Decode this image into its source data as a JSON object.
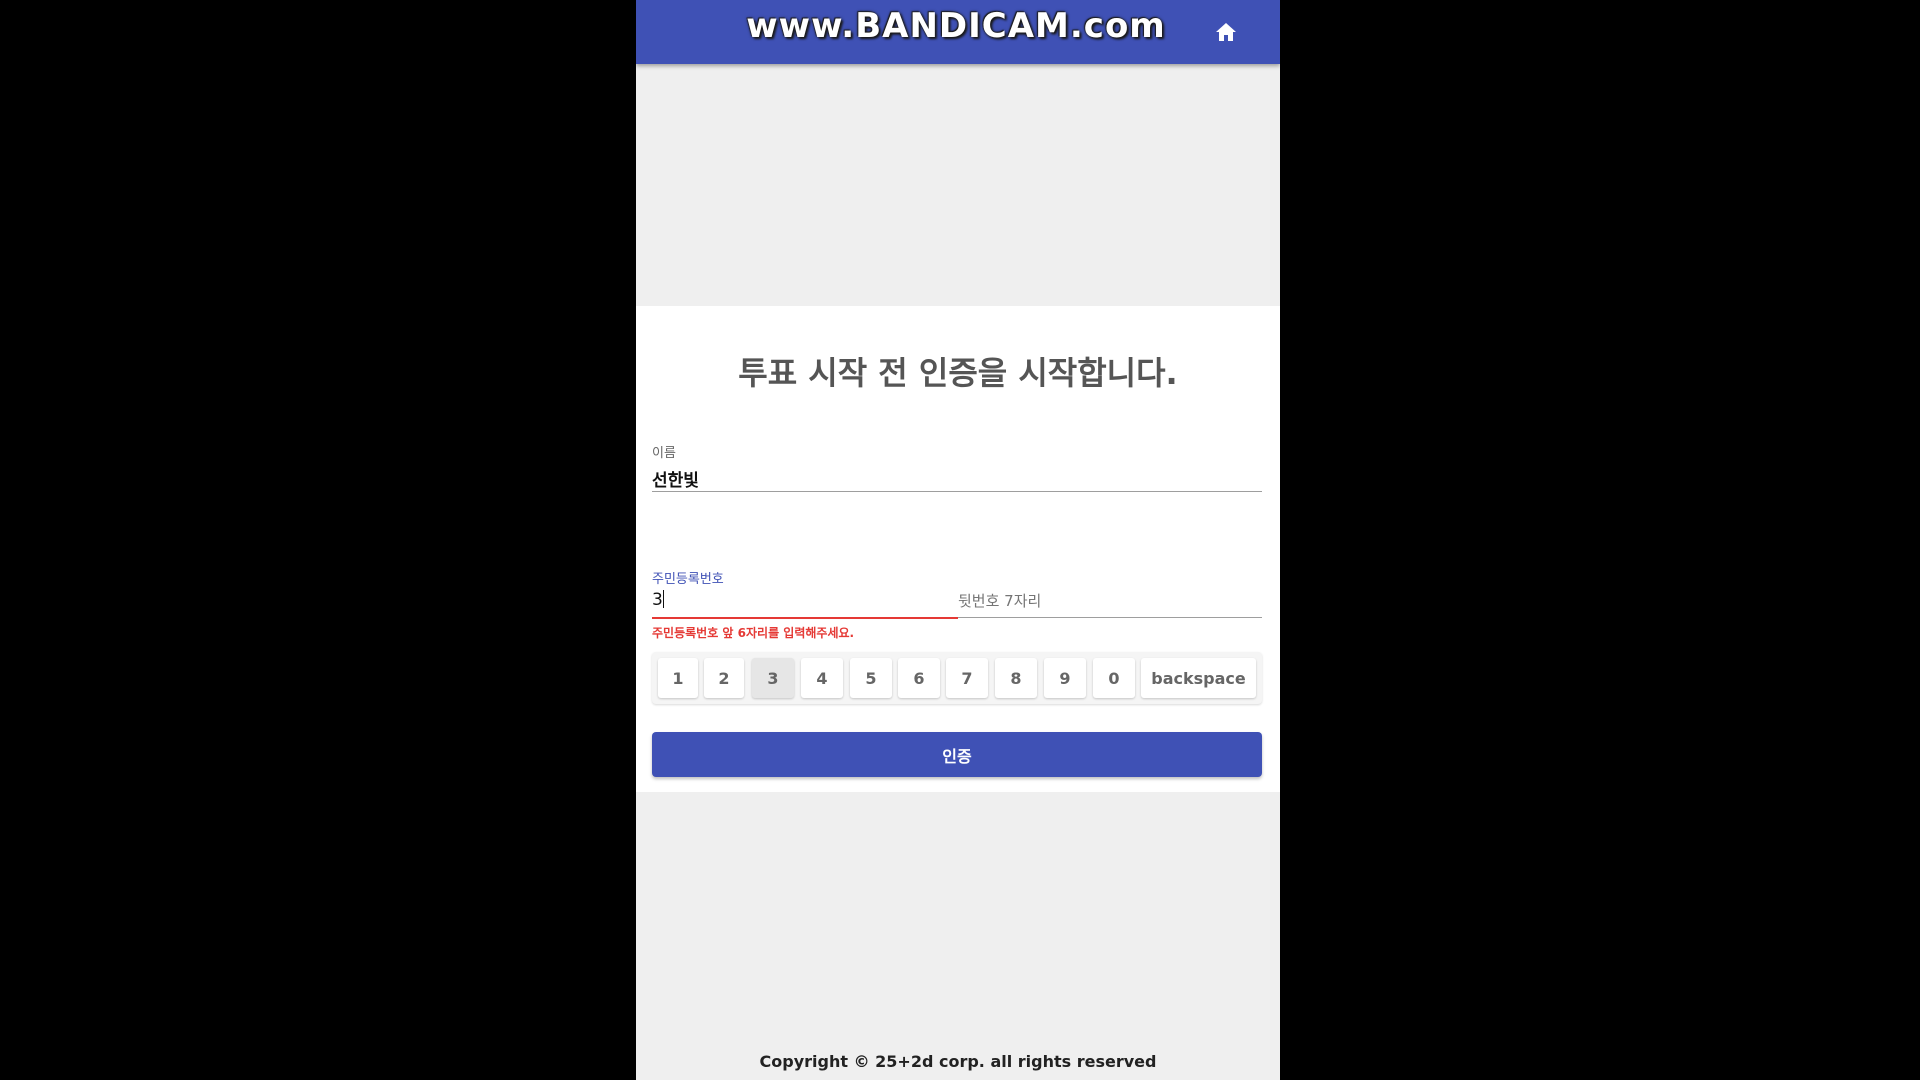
{
  "watermark": "www.BANDICAM.com",
  "header": {
    "home_icon": "home-icon",
    "bar_color": "#3f51b5"
  },
  "card": {
    "heading": "투표 시작 전 인증을 시작합니다.",
    "name_label": "이름",
    "name_value": "선한빛",
    "rrn_label": "주민등록번호",
    "rrn_front_value": "3",
    "rrn_back_placeholder": "뒷번호 7자리",
    "error_message": "주민등록번호 앞 6자리를 입력해주세요."
  },
  "keypad": {
    "keys": [
      "1",
      "2",
      "3",
      "4",
      "5",
      "6",
      "7",
      "8",
      "9",
      "0"
    ],
    "backspace_label": "backspace",
    "pressed_key": "3"
  },
  "submit_label": "인증",
  "footer": "Copyright © 25+2d corp. all rights reserved",
  "colors": {
    "primary": "#3f51b5",
    "error": "#e53935"
  }
}
